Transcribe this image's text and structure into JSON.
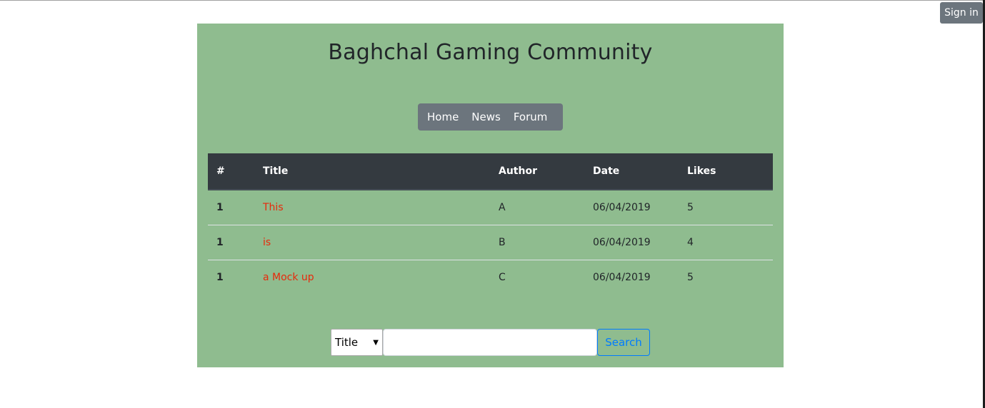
{
  "header": {
    "sign_in_label": "Sign in"
  },
  "main": {
    "title": "Baghchal Gaming Community",
    "nav": [
      {
        "label": "Home"
      },
      {
        "label": "News"
      },
      {
        "label": "Forum"
      }
    ],
    "table": {
      "columns": [
        "#",
        "Title",
        "Author",
        "Date",
        "Likes"
      ],
      "rows": [
        {
          "num": "1",
          "title": "This",
          "author": "A",
          "date": "06/04/2019",
          "likes": "5"
        },
        {
          "num": "1",
          "title": "is",
          "author": "B",
          "date": "06/04/2019",
          "likes": "4"
        },
        {
          "num": "1",
          "title": "a Mock up",
          "author": "C",
          "date": "06/04/2019",
          "likes": "5"
        }
      ]
    },
    "search": {
      "filter_selected": "Title",
      "input_value": "",
      "input_placeholder": "",
      "button_label": "Search"
    }
  },
  "colors": {
    "panel_bg": "#8fbc8f",
    "table_header_bg": "#343a40",
    "nav_bg": "#6c757d",
    "title_link": "#e8290b",
    "search_button": "#007bff"
  }
}
